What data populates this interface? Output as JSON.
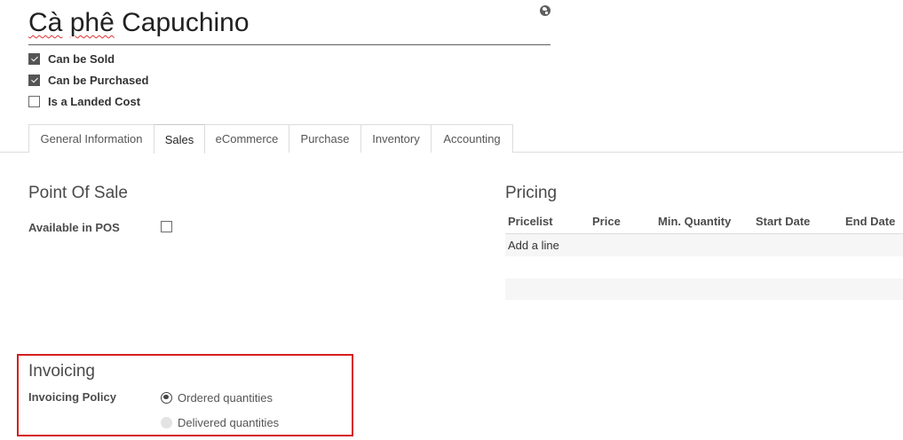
{
  "product": {
    "name_part1": "Cà",
    "name_part2": " ",
    "name_part3": "phê",
    "name_part4": " Capuchino"
  },
  "icons": {
    "translate": "globe-icon"
  },
  "flags": [
    {
      "label": "Can be Sold",
      "checked": true
    },
    {
      "label": "Can be Purchased",
      "checked": true
    },
    {
      "label": "Is a Landed Cost",
      "checked": false
    }
  ],
  "tabs": [
    {
      "label": "General Information"
    },
    {
      "label": "Sales",
      "active": true
    },
    {
      "label": "eCommerce"
    },
    {
      "label": "Purchase"
    },
    {
      "label": "Inventory"
    },
    {
      "label": "Accounting"
    }
  ],
  "point_of_sale": {
    "title": "Point Of Sale",
    "available_label": "Available in POS",
    "available_checked": false
  },
  "pricing": {
    "title": "Pricing",
    "columns": [
      "Pricelist",
      "Price",
      "Min. Quantity",
      "Start Date",
      "End Date"
    ],
    "add_line": "Add a line"
  },
  "invoicing": {
    "title": "Invoicing",
    "policy_label": "Invoicing Policy",
    "options": [
      {
        "label": "Ordered quantities",
        "selected": true
      },
      {
        "label": "Delivered quantities",
        "selected": false,
        "disabled": true
      }
    ]
  },
  "colors": {
    "highlight_box": "#d51d1d",
    "checkbox_checked": "#555555",
    "row_band": "#f6f6f6"
  }
}
